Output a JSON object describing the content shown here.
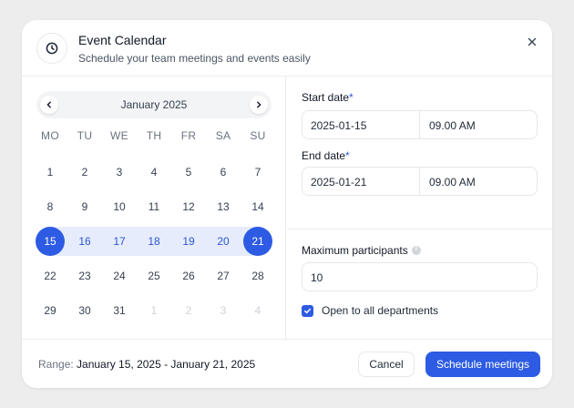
{
  "header": {
    "title": "Event Calendar",
    "subtitle": "Schedule your team meetings and events easily",
    "icon": "clock-icon",
    "close_icon": "close-icon"
  },
  "calendar": {
    "month_label": "January 2025",
    "prev_icon": "chevron-left-icon",
    "next_icon": "chevron-right-icon",
    "weekdays": [
      "MO",
      "TU",
      "WE",
      "TH",
      "FR",
      "SA",
      "SU"
    ],
    "days": [
      {
        "label": "1",
        "state": "normal"
      },
      {
        "label": "2",
        "state": "normal"
      },
      {
        "label": "3",
        "state": "normal"
      },
      {
        "label": "4",
        "state": "normal"
      },
      {
        "label": "5",
        "state": "normal"
      },
      {
        "label": "6",
        "state": "normal"
      },
      {
        "label": "7",
        "state": "normal"
      },
      {
        "label": "8",
        "state": "normal"
      },
      {
        "label": "9",
        "state": "normal"
      },
      {
        "label": "10",
        "state": "normal"
      },
      {
        "label": "11",
        "state": "normal"
      },
      {
        "label": "12",
        "state": "normal"
      },
      {
        "label": "13",
        "state": "normal"
      },
      {
        "label": "14",
        "state": "normal"
      },
      {
        "label": "15",
        "state": "range-start"
      },
      {
        "label": "16",
        "state": "in-range"
      },
      {
        "label": "17",
        "state": "in-range"
      },
      {
        "label": "18",
        "state": "in-range"
      },
      {
        "label": "19",
        "state": "in-range"
      },
      {
        "label": "20",
        "state": "in-range"
      },
      {
        "label": "21",
        "state": "range-end"
      },
      {
        "label": "22",
        "state": "normal"
      },
      {
        "label": "23",
        "state": "normal"
      },
      {
        "label": "24",
        "state": "normal"
      },
      {
        "label": "25",
        "state": "normal"
      },
      {
        "label": "26",
        "state": "normal"
      },
      {
        "label": "27",
        "state": "normal"
      },
      {
        "label": "28",
        "state": "normal"
      },
      {
        "label": "29",
        "state": "normal"
      },
      {
        "label": "30",
        "state": "normal"
      },
      {
        "label": "31",
        "state": "normal"
      },
      {
        "label": "1",
        "state": "muted"
      },
      {
        "label": "2",
        "state": "muted"
      },
      {
        "label": "3",
        "state": "muted"
      },
      {
        "label": "4",
        "state": "muted"
      }
    ]
  },
  "form": {
    "start": {
      "label": "Start date",
      "required_mark": "*",
      "date": "2025-01-15",
      "time": "09.00 AM"
    },
    "end": {
      "label": "End date",
      "required_mark": "*",
      "date": "2025-01-21",
      "time": "09.00 AM"
    },
    "participants": {
      "label": "Maximum participants",
      "value": "10",
      "info_icon": "info-icon"
    },
    "open_all": {
      "label": "Open to all departments",
      "checked": true
    }
  },
  "footer": {
    "range_prefix": "Range: ",
    "range_value": "January 15, 2025 - January 21, 2025",
    "cancel_label": "Cancel",
    "submit_label": "Schedule meetings"
  },
  "colors": {
    "accent": "#2d5be3",
    "range_fill": "#e6ecfb",
    "range_text": "#2b57d6"
  }
}
